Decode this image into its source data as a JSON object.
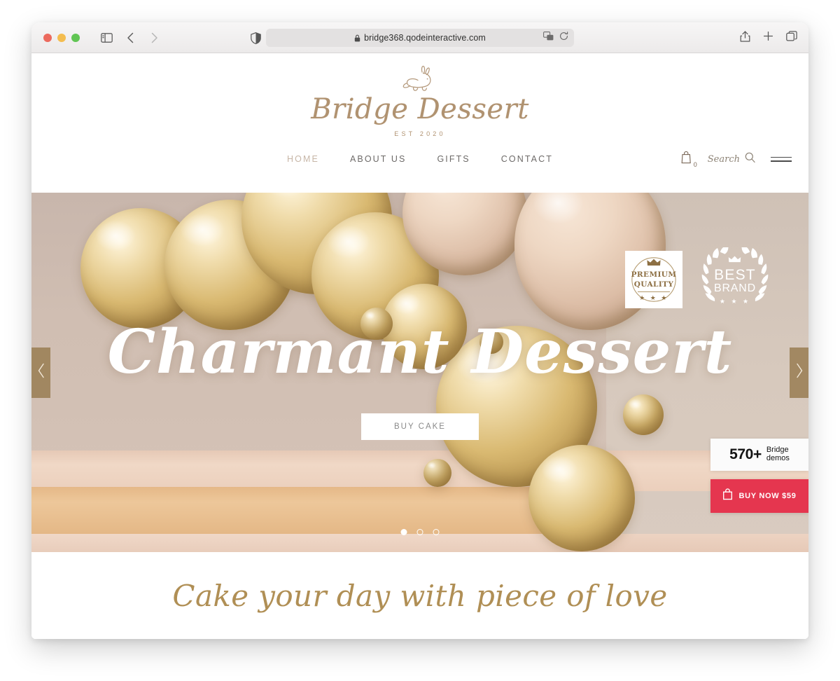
{
  "browser": {
    "url": "bridge368.qodeinteractive.com",
    "lock_icon": "lock-icon",
    "sidebar_icon": "sidebar-toggle-icon",
    "back_icon": "back-chevron-icon",
    "forward_icon": "forward-chevron-icon",
    "shield_icon": "privacy-shield-icon",
    "translate_icon": "translate-icon",
    "reload_icon": "reload-icon",
    "share_icon": "share-icon",
    "newtab_icon": "plus-icon",
    "tabs_icon": "tab-overview-icon",
    "traffic": [
      "close-red",
      "minimize-yellow",
      "zoom-green"
    ]
  },
  "site": {
    "logo": {
      "mark_icon": "rabbit-icon",
      "brand": "Bridge Dessert",
      "established": "EST 2020"
    },
    "nav": [
      {
        "label": "HOME",
        "active": true
      },
      {
        "label": "ABOUT US",
        "active": false
      },
      {
        "label": "GIFTS",
        "active": false
      },
      {
        "label": "CONTACT",
        "active": false
      }
    ],
    "nav_right": {
      "cart_icon": "shopping-bag-icon",
      "cart_count": "0",
      "search_label": "Search",
      "search_icon": "magnifier-icon",
      "menu_icon": "hamburger-menu-icon"
    },
    "hero": {
      "title": "Charmant Dessert",
      "cta_label": "BUY CAKE",
      "prev_icon": "chevron-left-icon",
      "next_icon": "chevron-right-icon",
      "slides_total": 3,
      "active_slide": 1,
      "badges": [
        {
          "name": "premium-quality-badge",
          "line1": "PREMIUM",
          "line2": "QUALITY",
          "stars": "★ ★ ★",
          "crown_icon": "crown-icon"
        },
        {
          "name": "best-brand-badge",
          "line1": "BEST",
          "line2": "BRAND",
          "stars": "★ ★ ★",
          "crown_icon": "crown-icon"
        }
      ]
    },
    "widgets": {
      "demo_count": "570+",
      "demo_label": "Bridge\ndemos",
      "buy_label": "BUY NOW $59",
      "buy_icon": "shopping-bag-icon",
      "buy_color": "#e5364f"
    },
    "tagline": "Cake your day with piece of love"
  },
  "colors": {
    "brand_gold": "#b09270",
    "nav_text": "#6d6a68",
    "nav_active": "#c7b6a7",
    "accent_red": "#e5364f",
    "arrow_bg": "rgba(150,122,78,.82)",
    "tagline_gold": "#b08f55"
  }
}
